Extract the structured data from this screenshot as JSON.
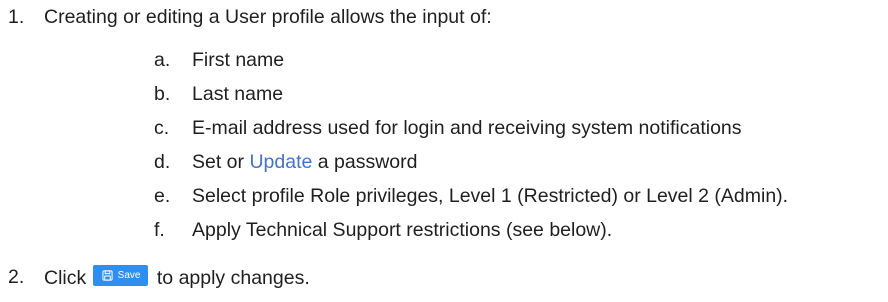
{
  "list": {
    "item1": {
      "marker": "1.",
      "text": "Creating or editing a User profile allows the input of:",
      "subitems": [
        {
          "marker": "a.",
          "text": "First name"
        },
        {
          "marker": "b.",
          "text": "Last name"
        },
        {
          "marker": "c.",
          "text": "E-mail address used for login and receiving system notifications"
        },
        {
          "marker": "d.",
          "prefix": "Set or ",
          "link": "Update",
          "suffix": " a password"
        },
        {
          "marker": "e.",
          "text": "Select profile Role privileges, Level 1 (Restricted) or Level 2 (Admin)."
        },
        {
          "marker": "f.",
          "text": "Apply Technical Support restrictions (see below)."
        }
      ]
    },
    "item2": {
      "marker": "2.",
      "prefix": "Click",
      "button_label": "Save",
      "button_icon": "save-icon",
      "suffix": "to apply changes."
    }
  },
  "colors": {
    "link": "#4472c4",
    "button_bg": "#2f8ff1",
    "button_text": "#ffffff",
    "text": "#1f1f1f"
  }
}
